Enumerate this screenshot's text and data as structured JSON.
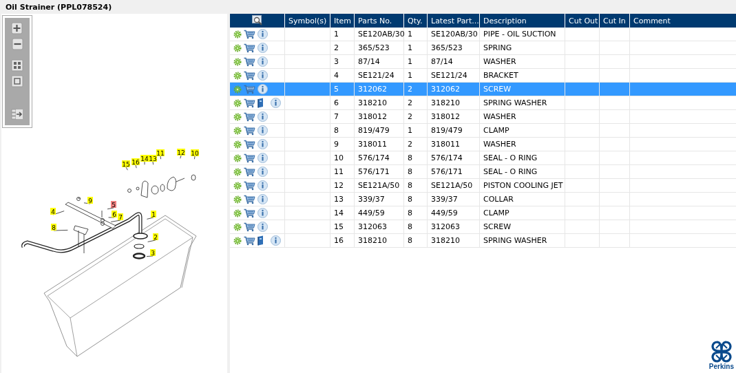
{
  "title": "Oil Strainer (PPL078524)",
  "toolbar": [
    {
      "kind": "zoom-in"
    },
    {
      "kind": "zoom-out"
    },
    {
      "kind": "fit"
    },
    {
      "kind": "actual"
    },
    {
      "kind": "export"
    }
  ],
  "callouts": [
    {
      "label": "15",
      "selected": false
    },
    {
      "label": "16",
      "selected": false
    },
    {
      "label": "14",
      "selected": false
    },
    {
      "label": "13",
      "selected": false
    },
    {
      "label": "11",
      "selected": false
    },
    {
      "label": "12",
      "selected": false
    },
    {
      "label": "10",
      "selected": false
    },
    {
      "label": "9",
      "selected": false
    },
    {
      "label": "5",
      "selected": true
    },
    {
      "label": "4",
      "selected": false
    },
    {
      "label": "6",
      "selected": false
    },
    {
      "label": "7",
      "selected": false
    },
    {
      "label": "1",
      "selected": false
    },
    {
      "label": "8",
      "selected": false
    },
    {
      "label": "2",
      "selected": false
    },
    {
      "label": "3",
      "selected": false
    }
  ],
  "table": {
    "columns": [
      "Symbol(s)",
      "Item",
      "Parts No.",
      "Qty.",
      "Latest Part...",
      "Description",
      "Cut Out",
      "Cut In",
      "Comment"
    ],
    "rows": [
      {
        "item": "1",
        "parts_no": "SE120AB/30",
        "qty": "1",
        "latest": "SE120AB/30",
        "description": "PIPE - OIL SUCTION",
        "book": false,
        "selected": false
      },
      {
        "item": "2",
        "parts_no": "365/523",
        "qty": "1",
        "latest": "365/523",
        "description": "SPRING",
        "book": false,
        "selected": false
      },
      {
        "item": "3",
        "parts_no": "87/14",
        "qty": "1",
        "latest": "87/14",
        "description": "WASHER",
        "book": false,
        "selected": false
      },
      {
        "item": "4",
        "parts_no": "SE121/24",
        "qty": "1",
        "latest": "SE121/24",
        "description": "BRACKET",
        "book": false,
        "selected": false
      },
      {
        "item": "5",
        "parts_no": "312062",
        "qty": "2",
        "latest": "312062",
        "description": "SCREW",
        "book": false,
        "selected": true
      },
      {
        "item": "6",
        "parts_no": "318210",
        "qty": "2",
        "latest": "318210",
        "description": "SPRING WASHER",
        "book": true,
        "selected": false
      },
      {
        "item": "7",
        "parts_no": "318012",
        "qty": "2",
        "latest": "318012",
        "description": "WASHER",
        "book": false,
        "selected": false
      },
      {
        "item": "8",
        "parts_no": "819/479",
        "qty": "1",
        "latest": "819/479",
        "description": "CLAMP",
        "book": false,
        "selected": false
      },
      {
        "item": "9",
        "parts_no": "318011",
        "qty": "2",
        "latest": "318011",
        "description": "WASHER",
        "book": false,
        "selected": false
      },
      {
        "item": "10",
        "parts_no": "576/174",
        "qty": "8",
        "latest": "576/174",
        "description": "SEAL - O RING",
        "book": false,
        "selected": false
      },
      {
        "item": "11",
        "parts_no": "576/171",
        "qty": "8",
        "latest": "576/171",
        "description": "SEAL - O RING",
        "book": false,
        "selected": false
      },
      {
        "item": "12",
        "parts_no": "SE121A/50",
        "qty": "8",
        "latest": "SE121A/50",
        "description": "PISTON COOLING JET",
        "book": false,
        "selected": false
      },
      {
        "item": "13",
        "parts_no": "339/37",
        "qty": "8",
        "latest": "339/37",
        "description": "COLLAR",
        "book": false,
        "selected": false
      },
      {
        "item": "14",
        "parts_no": "449/59",
        "qty": "8",
        "latest": "449/59",
        "description": "CLAMP",
        "book": false,
        "selected": false
      },
      {
        "item": "15",
        "parts_no": "312063",
        "qty": "8",
        "latest": "312063",
        "description": "SCREW",
        "book": false,
        "selected": false
      },
      {
        "item": "16",
        "parts_no": "318210",
        "qty": "8",
        "latest": "318210",
        "description": "SPRING WASHER",
        "book": true,
        "selected": false
      }
    ]
  },
  "logo": {
    "text": "Perkins"
  }
}
